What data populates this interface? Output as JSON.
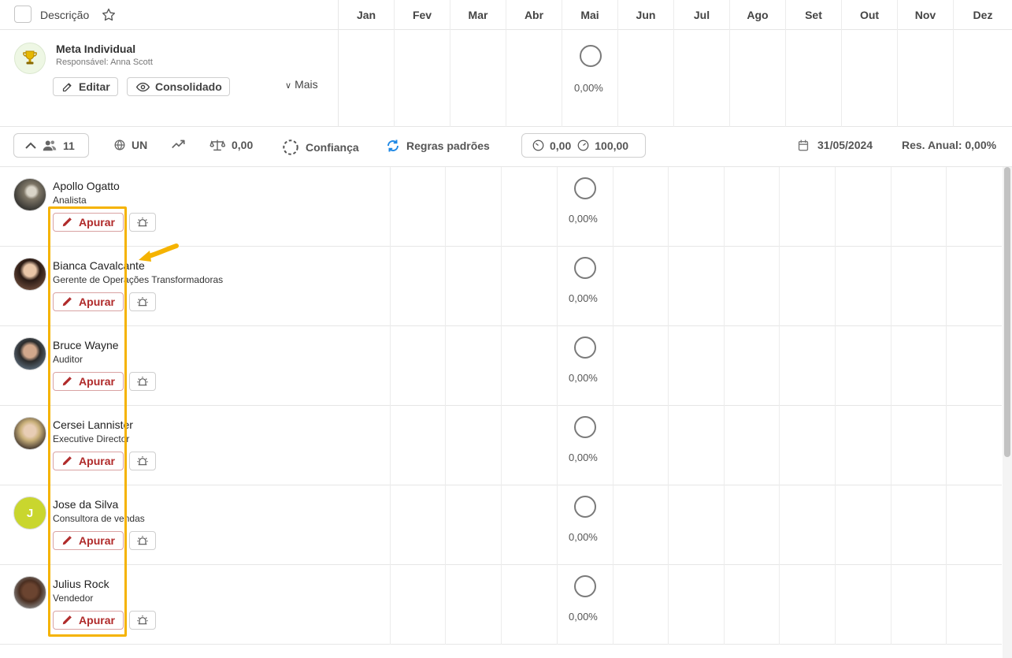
{
  "header": {
    "description_label": "Descrição",
    "months": [
      "Jan",
      "Fev",
      "Mar",
      "Abr",
      "Mai",
      "Jun",
      "Jul",
      "Ago",
      "Set",
      "Out",
      "Nov",
      "Dez"
    ]
  },
  "goal": {
    "title": "Meta Individual",
    "responsible": "Responsável: Anna Scott",
    "edit_label": "Editar",
    "consolidated_label": "Consolidado",
    "more_label": "Mais",
    "may_value": "0,00%"
  },
  "toolbar": {
    "members_count": "11",
    "unit": "UN",
    "weight": "0,00",
    "confidence": "Confiança",
    "rules": "Regras padrões",
    "range_min": "0,00",
    "range_max": "100,00",
    "date": "31/05/2024",
    "annual_result": "Res. Anual: 0,00%"
  },
  "users": [
    {
      "name": "Apollo Ogatto",
      "role": "Analista",
      "action": "Apurar",
      "may_value": "0,00%",
      "avatar": "photo"
    },
    {
      "name": "Bianca Cavalcante",
      "role": "Gerente de Operações Transformadoras",
      "action": "Apurar",
      "may_value": "0,00%",
      "avatar": "photo"
    },
    {
      "name": "Bruce Wayne",
      "role": "Auditor",
      "action": "Apurar",
      "may_value": "0,00%",
      "avatar": "photo"
    },
    {
      "name": "Cersei Lannister",
      "role": "Executive Director",
      "action": "Apurar",
      "may_value": "0,00%",
      "avatar": "photo"
    },
    {
      "name": "Jose da Silva",
      "role": "Consultora de vendas",
      "action": "Apurar",
      "may_value": "0,00%",
      "avatar": "J"
    },
    {
      "name": "Julius Rock",
      "role": "Vendedor",
      "action": "Apurar",
      "may_value": "0,00%",
      "avatar": "photo"
    }
  ],
  "colors": {
    "highlight": "#f5b301",
    "apurar_text": "#b02a2a",
    "rules_icon": "#1e88e5",
    "initial_avatar_bg": "#c9d62e"
  }
}
